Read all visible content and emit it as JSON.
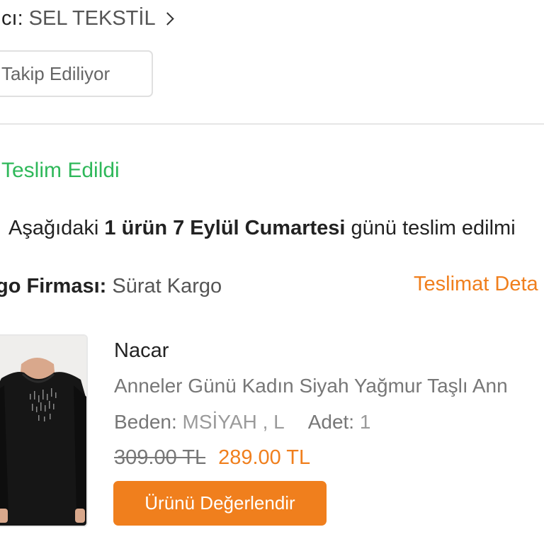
{
  "seller": {
    "label": "ıcı:",
    "name": "SEL TEKSTİL"
  },
  "follow_button": {
    "label": "Takip Ediliyor"
  },
  "shipment": {
    "status": "Teslim Edildi",
    "status_color": "#2fb85a",
    "message_prefix": "Aşağıdaki",
    "message_count": "1 ürün",
    "message_date": "7 Eylül Cumartesi",
    "message_suffix": "günü teslim edilmi",
    "cargo_label": "go Firması:",
    "cargo_value": "Sürat Kargo",
    "detail_link": "Teslimat Deta"
  },
  "product": {
    "brand": "Nacar",
    "title": "Anneler Günü Kadın Siyah Yağmur Taşlı Ann",
    "size_label": "Beden:",
    "size_value": "MSİYAH , L",
    "quantity_label": "Adet:",
    "quantity_value": "1",
    "old_price": "309.00 TL",
    "new_price": "289.00 TL",
    "image_icon": "product-photo-black-blouse"
  },
  "review_button": {
    "label": "Ürünü Değerlendir"
  },
  "colors": {
    "accent": "#f07f1d",
    "success": "#2fb85a"
  }
}
